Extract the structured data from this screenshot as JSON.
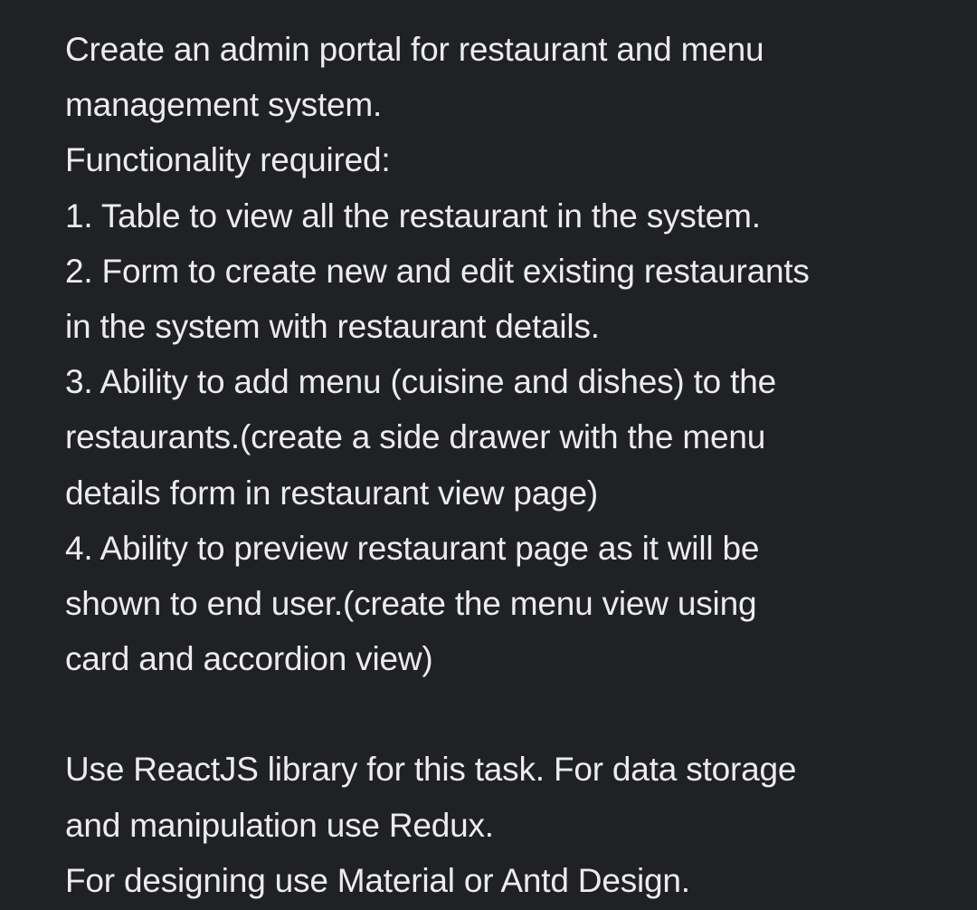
{
  "message": {
    "lines": [
      "Create an admin portal for restaurant and menu",
      "management system.",
      "Functionality required:",
      "1. Table to view all the restaurant in the system.",
      "2. Form to create new and edit existing restaurants",
      "in the system with restaurant details.",
      "3. Ability to add menu (cuisine and dishes) to the",
      "restaurants.(create a side drawer with the menu",
      "details form in restaurant view page)",
      "4. Ability to preview restaurant page as it will be",
      "shown to end user.(create the menu view using",
      "card and accordion view)",
      "",
      "Use ReactJS library for this task. For data storage",
      "and manipulation use Redux.",
      "For designing use Material or Antd Design."
    ]
  }
}
